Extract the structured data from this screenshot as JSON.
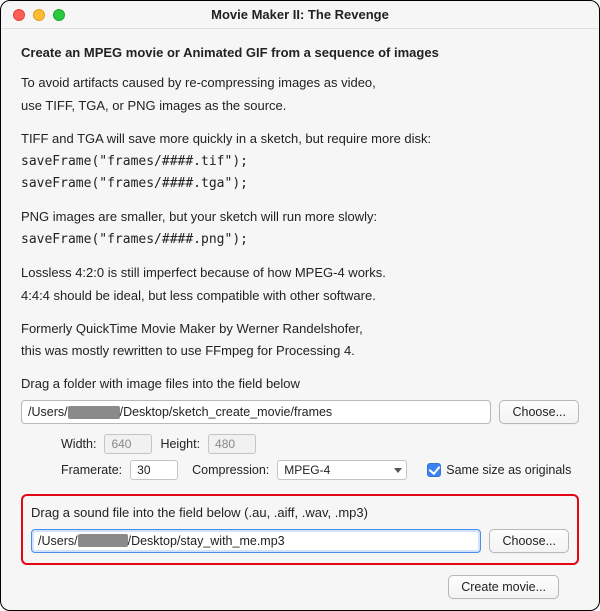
{
  "window": {
    "title": "Movie Maker II: The Revenge"
  },
  "heading": "Create an MPEG movie or Animated GIF from a sequence of images",
  "p1a": "To avoid artifacts caused by re-compressing images as video,",
  "p1b": "use TIFF, TGA, or PNG images as the source.",
  "p2": "TIFF and TGA will save more quickly in a sketch, but require more disk:",
  "code1": "saveFrame(\"frames/####.tif\");",
  "code2": "saveFrame(\"frames/####.tga\");",
  "p3": "PNG images are smaller, but your sketch will run more slowly:",
  "code3": "saveFrame(\"frames/####.png\");",
  "p4a": "Lossless 4:2:0 is still imperfect because of how MPEG-4 works.",
  "p4b": "4:4:4 should be ideal, but less compatible with other software.",
  "p5a": "Formerly QuickTime Movie Maker by Werner Randelshofer,",
  "p5b": "this was mostly rewritten to use FFmpeg for Processing 4.",
  "imgSection": {
    "label": "Drag a folder with image files into the field below",
    "path_prefix": "/Users/",
    "path_suffix": "/Desktop/sketch_create_movie/frames",
    "choose": "Choose..."
  },
  "fields": {
    "width_label": "Width:",
    "width": "640",
    "height_label": "Height:",
    "height": "480",
    "framerate_label": "Framerate:",
    "framerate": "30",
    "compression_label": "Compression:",
    "compression": "MPEG-4",
    "samesize": "Same size as originals"
  },
  "soundSection": {
    "label": "Drag a sound file into the field below (.au, .aiff, .wav, .mp3)",
    "path_prefix": "/Users/",
    "path_suffix": "/Desktop/stay_with_me.mp3",
    "choose": "Choose..."
  },
  "footer": {
    "create": "Create movie..."
  }
}
